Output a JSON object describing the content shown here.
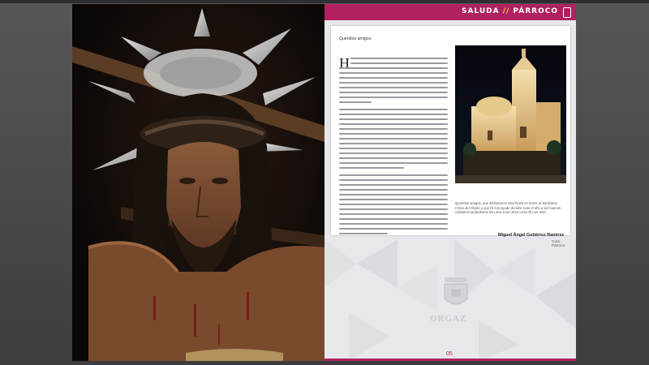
{
  "header": {
    "section": "SALUDA",
    "separator": "//",
    "subsection": "PÁRROCO"
  },
  "letter": {
    "greeting": "Queridos amigos:",
    "dropcap": "H",
    "closing_text": "Queridos amigos, que disfrutemos esta fiesta en honor al Santísimo Cristo del Olvido y que Él nos ayude durante todo el año a ser buenos cristianos amándonos los unos a los otros como Él nos amó."
  },
  "signature": {
    "name": "Miguel Ángel Gutiérrez Ramírez",
    "role": "Cura Párroco"
  },
  "footer": {
    "town": "ORGAZ",
    "page_number": "05"
  },
  "colors": {
    "accent": "#b0215f",
    "separator_accent": "#ffd25a"
  }
}
